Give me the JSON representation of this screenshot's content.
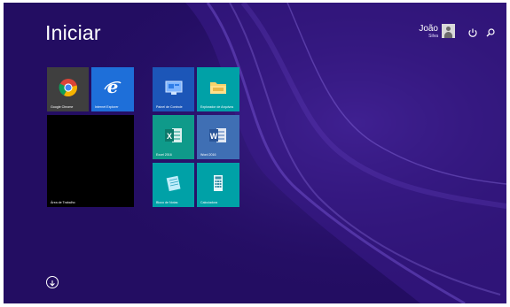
{
  "start": {
    "title": "Iniciar"
  },
  "user": {
    "first_name": "João",
    "last_name": "Silva"
  },
  "icons": {
    "power": "power-icon",
    "search": "search-icon",
    "apps": "arrow-down-circle-icon"
  },
  "tiles": {
    "chrome": {
      "label": "Google Chrome",
      "color": "#3f3f3f"
    },
    "ie": {
      "label": "Internet Explorer",
      "color": "#1e6fd9"
    },
    "desktop": {
      "label": "Área de Trabalho",
      "color": "#000000"
    },
    "control_panel": {
      "label": "Painel de Controle",
      "color": "#1c56b8"
    },
    "explorer": {
      "label": "Explorador de Arquivos",
      "color": "#00a1a7"
    },
    "excel": {
      "label": "Excel 2016",
      "color": "#0f9a8a"
    },
    "word": {
      "label": "Word 2016",
      "color": "#3f6fb4"
    },
    "notepad": {
      "label": "Bloco de Notas",
      "color": "#00a1a7"
    },
    "calculator": {
      "label": "Calculadora",
      "color": "#00a1a7"
    }
  },
  "colors": {
    "background": "#230d62"
  }
}
